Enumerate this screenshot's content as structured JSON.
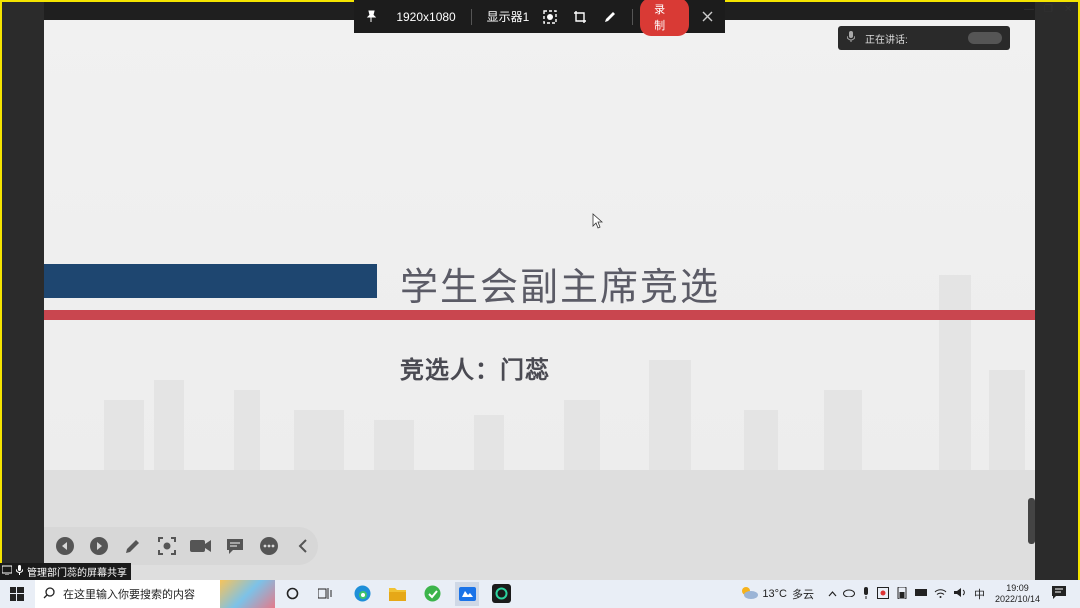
{
  "topbar": {
    "resolution": "1920x1080",
    "display": "显示器1",
    "record_label": "录制"
  },
  "speaking": {
    "label": "正在讲话:"
  },
  "slide": {
    "title": "学生会副主席竞选",
    "subtitle": "竞选人：门蕊"
  },
  "share": {
    "label": "管理部门蕊的屏幕共享"
  },
  "taskbar": {
    "search_placeholder": "在这里输入你要搜索的内容",
    "weather_temp": "13°C",
    "weather_text": "多云",
    "ime": "中",
    "time": "19:09",
    "date": "2022/10/14"
  },
  "colors": {
    "blue_bar": "#1e4670",
    "red_bar": "#c9464f",
    "record": "#d93a35"
  }
}
